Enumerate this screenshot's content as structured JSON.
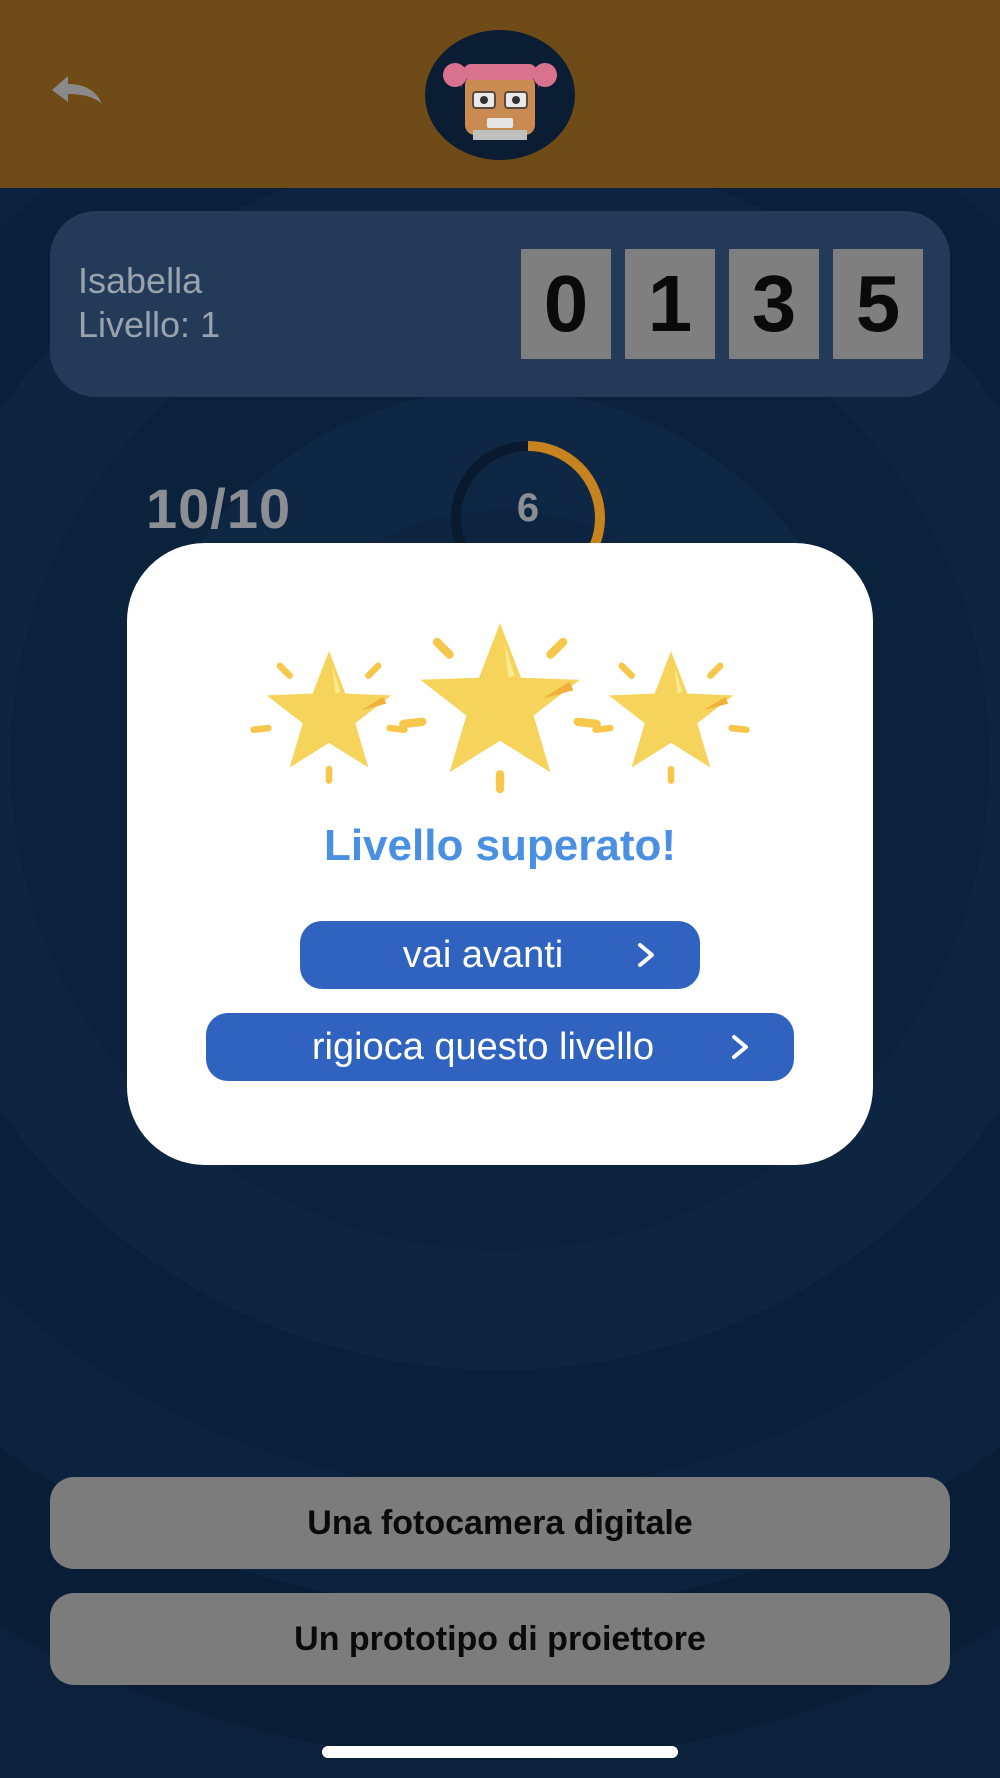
{
  "header": {
    "back_icon": "undo-arrow-icon",
    "avatar_icon": "girl-avatar-icon",
    "background_color": "#6f4b17"
  },
  "player": {
    "name": "Isabella",
    "level_label": "Livello: 1",
    "score_digits": [
      "0",
      "1",
      "3",
      "5"
    ]
  },
  "progress": {
    "questions_label": "10/10",
    "timer_value": "6",
    "timer_remaining_fraction": 0.6
  },
  "modal": {
    "stars_earned": 3,
    "star_icon": "star-icon",
    "title": "Livello superato!",
    "next_label": "vai avanti",
    "replay_label": "rigioca questo livello",
    "title_color": "#4a90e2",
    "button_color": "#2f63bf"
  },
  "answers": [
    {
      "label": "Una fotocamera digitale"
    },
    {
      "label": "Un prototipo di proiettore"
    }
  ]
}
